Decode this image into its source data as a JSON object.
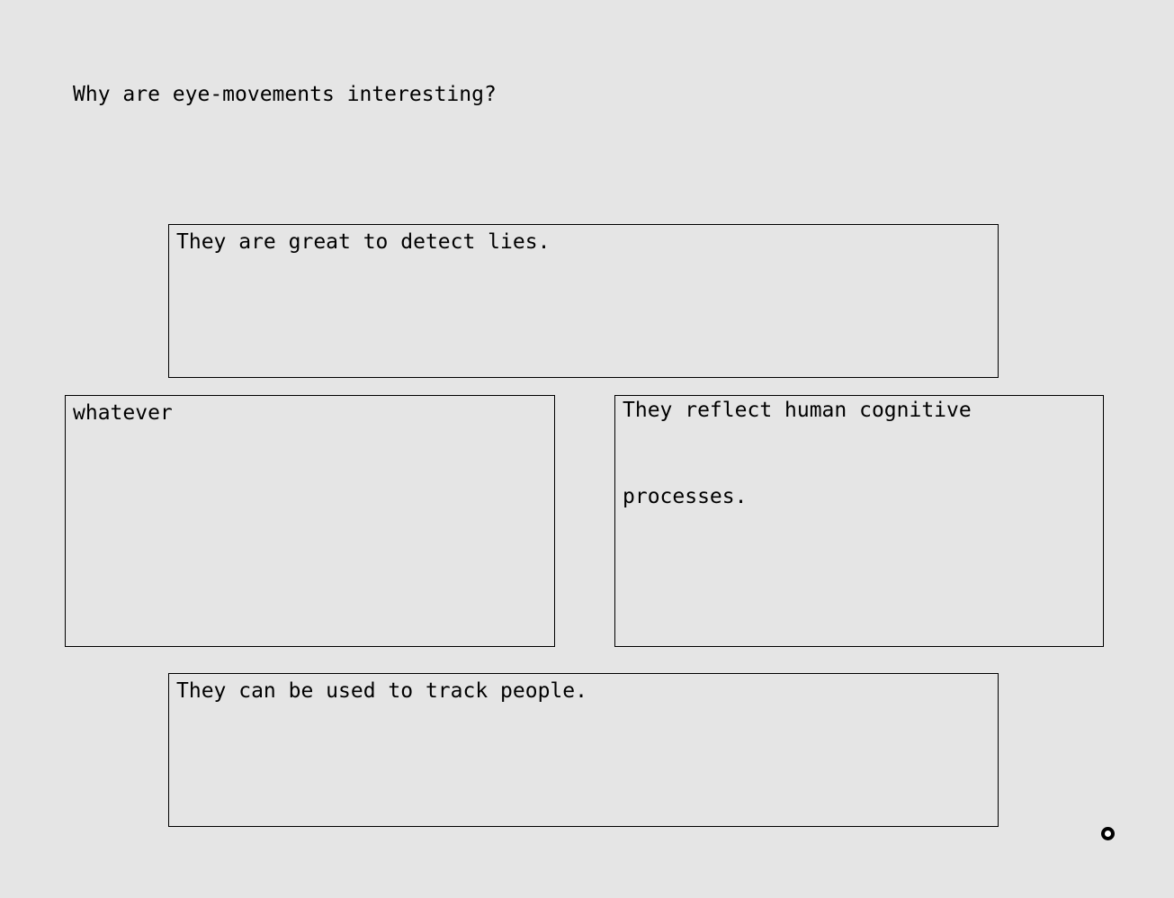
{
  "question": "Why are eye-movements interesting?",
  "options": {
    "top": "They are great to detect lies.",
    "left": "whatever",
    "right": "They reflect human cognitive processes.",
    "bottom": "They can be used to track people."
  },
  "cursor_icon": "gaze-cursor-icon"
}
